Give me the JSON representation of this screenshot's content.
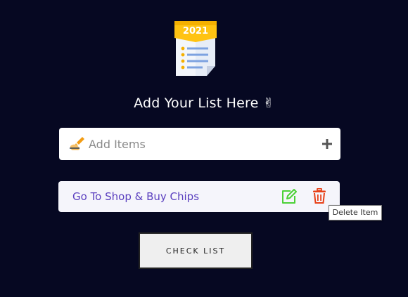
{
  "logo": {
    "year": "2021",
    "icon": "notepad-2021-icon"
  },
  "heading": {
    "text": "Add Your List Here ✌"
  },
  "add_item": {
    "placeholder": "Add Items",
    "value": "",
    "leading_icon": "writing-hand-icon",
    "add_icon": "plus-icon"
  },
  "items": [
    {
      "text": "Go To Shop & Buy Chips",
      "edit_icon": "edit-icon",
      "delete_icon": "trash-icon",
      "edit_color": "#4cd137",
      "delete_color": "#e84118"
    }
  ],
  "tooltip": {
    "text": "Delete Item"
  },
  "check_list": {
    "label": "CHECK LIST"
  },
  "colors": {
    "background": "#060822",
    "item_text": "#5a3fbf",
    "logo_banner": "#ffc312"
  }
}
